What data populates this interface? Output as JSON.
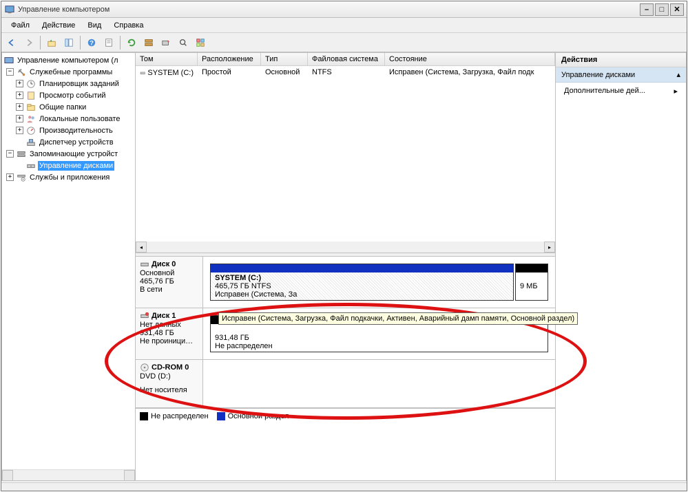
{
  "window": {
    "title": "Управление компьютером"
  },
  "menu": {
    "file": "Файл",
    "action": "Действие",
    "view": "Вид",
    "help": "Справка"
  },
  "tree": {
    "root": "Управление компьютером (л",
    "utilities": "Служебные программы",
    "scheduler": "Планировщик заданий",
    "eventviewer": "Просмотр событий",
    "sharedfolders": "Общие папки",
    "localusers": "Локальные пользовате",
    "performance": "Производительность",
    "devicemgr": "Диспетчер устройств",
    "storage": "Запоминающие устройст",
    "diskmgmt": "Управление дисками",
    "services": "Службы и приложения"
  },
  "columns": {
    "vol": "Том",
    "layout": "Расположение",
    "type": "Тип",
    "fs": "Файловая система",
    "status": "Состояние"
  },
  "row1": {
    "vol": "SYSTEM (C:)",
    "layout": "Простой",
    "type": "Основной",
    "fs": "NTFS",
    "status": "Исправен (Система, Загрузка, Файл подк"
  },
  "disk0": {
    "name": "Диск 0",
    "kind": "Основной",
    "size": "465,76 ГБ",
    "online": "В сети",
    "part1_name": "SYSTEM (C:)",
    "part1_detail": "465,75 ГБ NTFS",
    "part1_status": "Исправен (Система, За",
    "part2_size": "9 МБ",
    "tooltip": "Исправен (Система, Загрузка, Файл подкачки, Активен, Аварийный дамп памяти, Основной раздел)"
  },
  "disk1": {
    "name": "Диск 1",
    "kind": "Нет данных",
    "size": "931,48 ГБ",
    "status": "Не проиници…",
    "part_size": "931,48 ГБ",
    "part_status": "Не распределен"
  },
  "cdrom": {
    "name": "CD-ROM 0",
    "type": "DVD (D:)",
    "media": "Нет носителя"
  },
  "legend": {
    "unalloc": "Не распределен",
    "primary": "Основной раздел"
  },
  "actions": {
    "header": "Действия",
    "section": "Управление дисками",
    "more": "Дополнительные дей...",
    "arrow": "▴",
    "play": "▸"
  }
}
